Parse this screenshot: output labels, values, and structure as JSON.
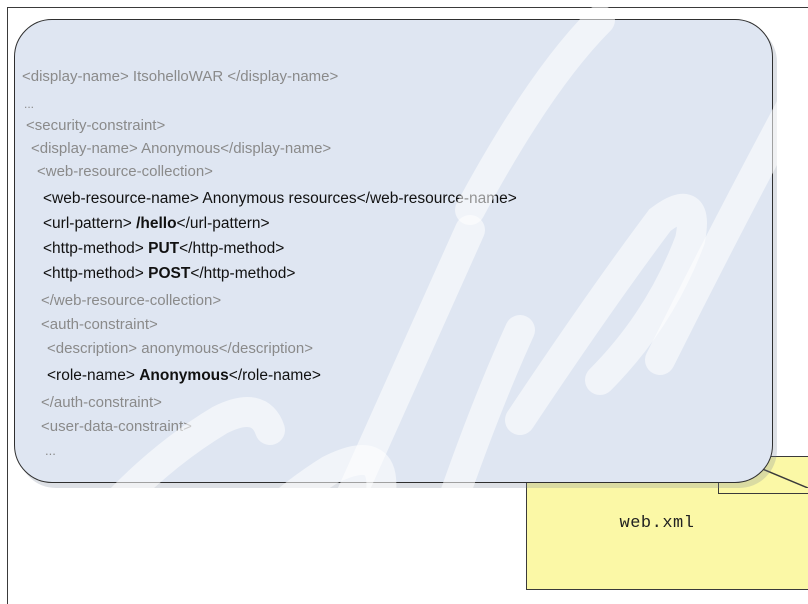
{
  "file_label": "web.xml",
  "code_lines": [
    {
      "text": "<display-name> ItsohelloWAR </display-name>"
    },
    {
      "text": "..."
    },
    {
      "text": "<security-constraint>"
    },
    {
      "text": "<display-name> Anonymous</display-name>"
    },
    {
      "text": "<web-resource-collection>"
    },
    {
      "pre": "<web-resource-name> Anonymous resources</web-resource-name>",
      "bold": "",
      "post": ""
    },
    {
      "pre": "<url-pattern> ",
      "bold": "/hello",
      "post": "</url-pattern>"
    },
    {
      "pre": "<http-method> ",
      "bold": "PUT",
      "post": "</http-method>"
    },
    {
      "pre": "<http-method> ",
      "bold": "POST",
      "post": "</http-method>"
    },
    {
      "text": "</web-resource-collection>"
    },
    {
      "text": "<auth-constraint>"
    },
    {
      "text": "<description> anonymous</description>"
    },
    {
      "pre": "<role-name> ",
      "bold": "Anonymous",
      "post": "</role-name>"
    },
    {
      "text": "</auth-constraint>"
    },
    {
      "text": "<user-data-constraint>"
    },
    {
      "text": "..."
    }
  ],
  "colors": {
    "callout_fill": "#dfe6f2",
    "note_fill": "#fbf8a6",
    "muted_text": "#8a8a8a",
    "emphasis_text": "#111111"
  }
}
